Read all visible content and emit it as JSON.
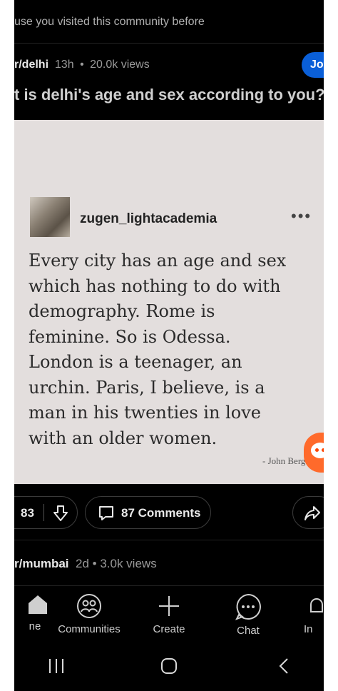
{
  "feed": {
    "recommendation_reason": "use you visited this community before"
  },
  "post1": {
    "subreddit": "r/delhi",
    "age": "13h",
    "views": "20.0k views",
    "join_label": "Jo",
    "title": "t is delhi's age and sex according to you?",
    "image": {
      "username": "zugen_lightacademia",
      "more_label": "•••",
      "quote": "Every city has an age and sex which has nothing to do with demography. Rome is feminine. So is Odessa. London is a teenager, an urchin. Paris, I believe, is a man in his twenties in love with an older women.",
      "author": "- John Berg"
    },
    "votes": "83",
    "comments_label": "87 Comments"
  },
  "post2": {
    "subreddit": "r/mumbai",
    "age": "2d",
    "views": "3.0k views"
  },
  "nav": {
    "home_label": "ne",
    "communities_label": "Communities",
    "create_label": "Create",
    "chat_label": "Chat",
    "inbox_label": "In"
  },
  "colors": {
    "background": "#000000",
    "join_button": "#0a5fd8",
    "image_background": "#e3dedd",
    "reddit_orange": "#ff4500"
  }
}
